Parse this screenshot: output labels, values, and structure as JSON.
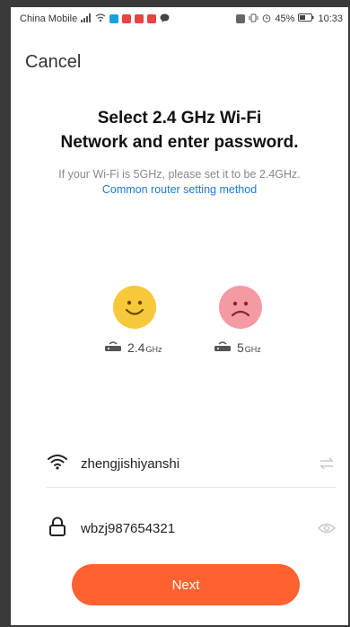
{
  "status_bar": {
    "carrier": "China Mobile",
    "battery": "45%",
    "time": "10:33"
  },
  "header": {
    "cancel_label": "Cancel"
  },
  "main": {
    "title_line1": "Select 2.4 GHz Wi-Fi",
    "title_line2": "Network and enter password.",
    "subtitle_text": "If your Wi-Fi is 5GHz, please set it to be 2.4GHz.",
    "subtitle_link": "Common router setting method",
    "band_24_value": "2.4",
    "band_24_unit": "GHz",
    "band_5_value": "5",
    "band_5_unit": "GHz"
  },
  "form": {
    "ssid_value": "zhengjishiyanshi",
    "password_value": "wbzj987654321",
    "next_label": "Next"
  },
  "colors": {
    "accent": "#ff6130",
    "link": "#1a7bd8",
    "happy_face": "#f7c93a",
    "sad_face": "#f49aa3"
  }
}
